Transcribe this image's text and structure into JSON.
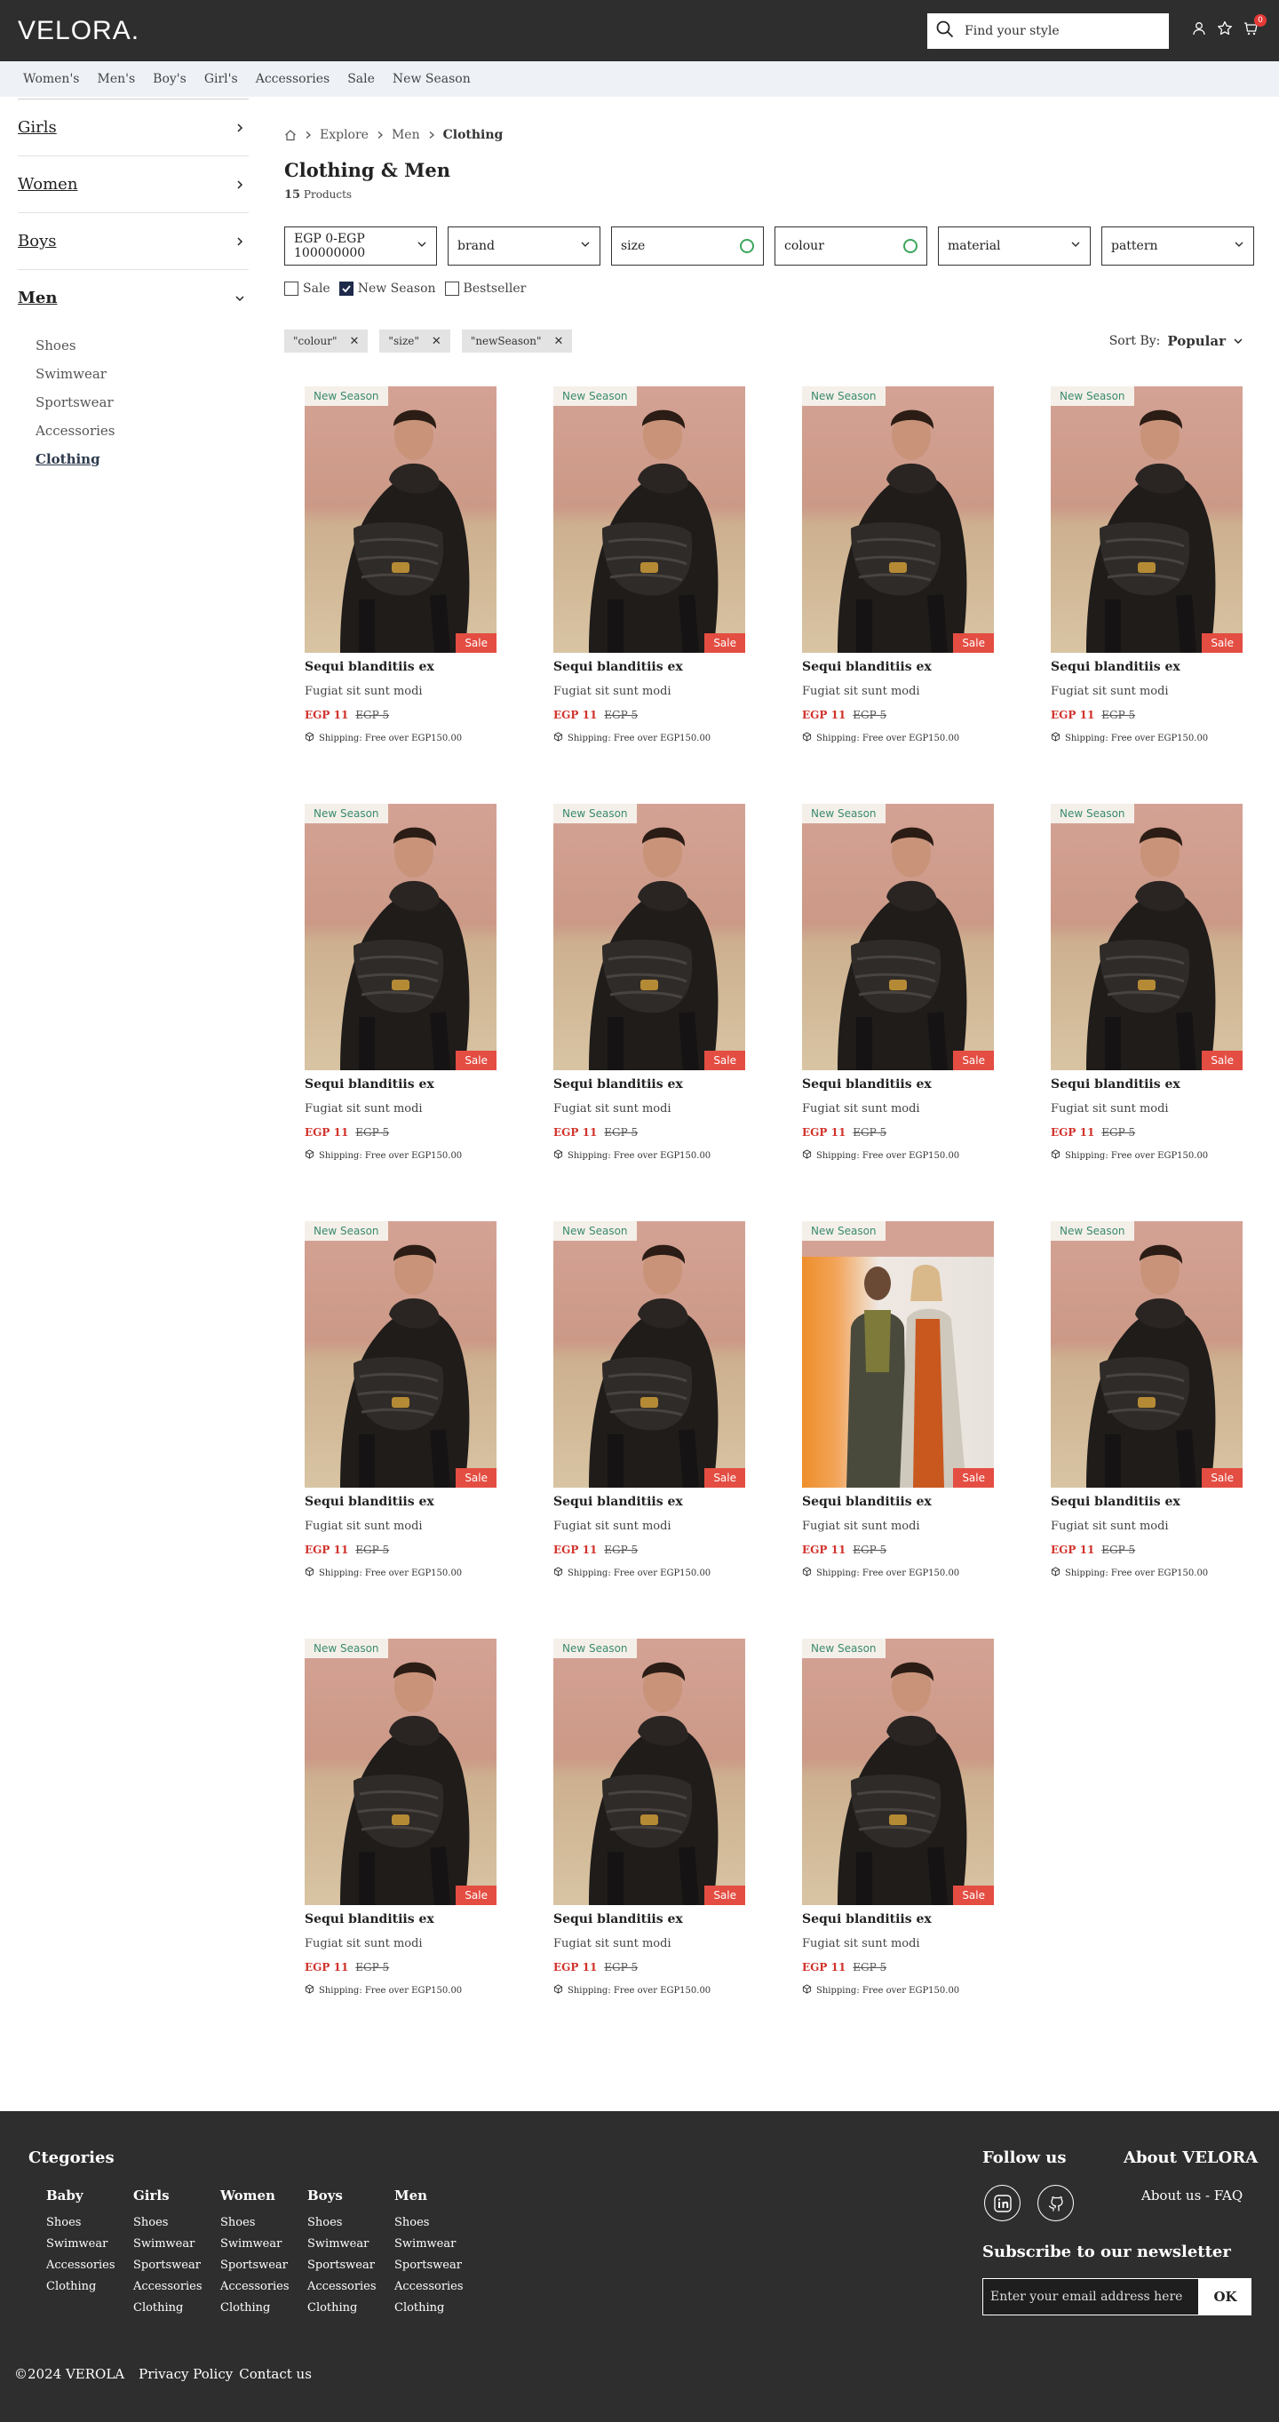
{
  "header": {
    "logo": "VELORA.",
    "search_placeholder": "Find your style",
    "cart_count": "0"
  },
  "nav": [
    "Women's",
    "Men's",
    "Boy's",
    "Girl's",
    "Accessories",
    "Sale",
    "New Season"
  ],
  "sidebar": {
    "categories": [
      {
        "label": "Girls",
        "expanded": false
      },
      {
        "label": "Women",
        "expanded": false
      },
      {
        "label": "Boys",
        "expanded": false
      },
      {
        "label": "Men",
        "expanded": true
      }
    ],
    "subcategories": [
      "Shoes",
      "Swimwear",
      "Sportswear",
      "Accessories",
      "Clothing"
    ],
    "active_subcategory": "Clothing"
  },
  "breadcrumb": [
    "Explore",
    "Men",
    "Clothing"
  ],
  "page": {
    "title": "Clothing & Men",
    "count": "15",
    "count_label": "Products"
  },
  "filters": [
    {
      "label": "EGP 0-EGP 100000000",
      "kind": "select"
    },
    {
      "label": "brand",
      "kind": "select"
    },
    {
      "label": "size",
      "kind": "ring"
    },
    {
      "label": "colour",
      "kind": "ring"
    },
    {
      "label": "material",
      "kind": "select"
    },
    {
      "label": "pattern",
      "kind": "select"
    }
  ],
  "checkboxes": [
    {
      "label": "Sale",
      "checked": false
    },
    {
      "label": "New Season",
      "checked": true
    },
    {
      "label": "Bestseller",
      "checked": false
    }
  ],
  "chips": [
    "\"colour\"",
    "\"size\"",
    "\"newSeason\""
  ],
  "sort": {
    "label": "Sort By:",
    "value": "Popular"
  },
  "product_template": {
    "name": "Sequi blanditiis ex",
    "desc": "Fugiat sit sunt modi",
    "price": "EGP 11",
    "old_price": "EGP 5",
    "shipping": "Shipping: Free over EGP150.00",
    "badge_new": "New Season",
    "badge_sale": "Sale"
  },
  "products": [
    {
      "image": "man-jacket"
    },
    {
      "image": "man-jacket"
    },
    {
      "image": "man-jacket"
    },
    {
      "image": "man-jacket"
    },
    {
      "image": "man-jacket"
    },
    {
      "image": "man-jacket"
    },
    {
      "image": "man-jacket"
    },
    {
      "image": "man-jacket"
    },
    {
      "image": "man-jacket"
    },
    {
      "image": "man-jacket"
    },
    {
      "image": "couple"
    },
    {
      "image": "man-jacket"
    },
    {
      "image": "man-jacket"
    },
    {
      "image": "man-jacket"
    },
    {
      "image": "man-jacket"
    }
  ],
  "footer": {
    "categories_title": "Ctegories",
    "columns": [
      {
        "title": "Baby",
        "items": [
          "Shoes",
          "Swimwear",
          "Accessories",
          "Clothing"
        ]
      },
      {
        "title": "Girls",
        "items": [
          "Shoes",
          "Swimwear",
          "Sportswear",
          "Accessories",
          "Clothing"
        ]
      },
      {
        "title": "Women",
        "items": [
          "Shoes",
          "Swimwear",
          "Sportswear",
          "Accessories",
          "Clothing"
        ]
      },
      {
        "title": "Boys",
        "items": [
          "Shoes",
          "Swimwear",
          "Sportswear",
          "Accessories",
          "Clothing"
        ]
      },
      {
        "title": "Men",
        "items": [
          "Shoes",
          "Swimwear",
          "Sportswear",
          "Accessories",
          "Clothing"
        ]
      }
    ],
    "follow_title": "Follow us",
    "about_title": "About VELORA",
    "about_link": "About us - FAQ",
    "newsletter_title": "Subscribe to our newsletter",
    "newsletter_placeholder": "Enter your email address here",
    "newsletter_button": "OK",
    "copyright": "©2024 VEROLA",
    "privacy": "Privacy Policy",
    "contact": "Contact us"
  },
  "colors": {
    "header_bg": "#2e2e2e",
    "sale_red": "#e44d42",
    "price_red": "#d1322b",
    "new_season_green": "#3a8a6e",
    "ring_green": "#3ca65b"
  }
}
